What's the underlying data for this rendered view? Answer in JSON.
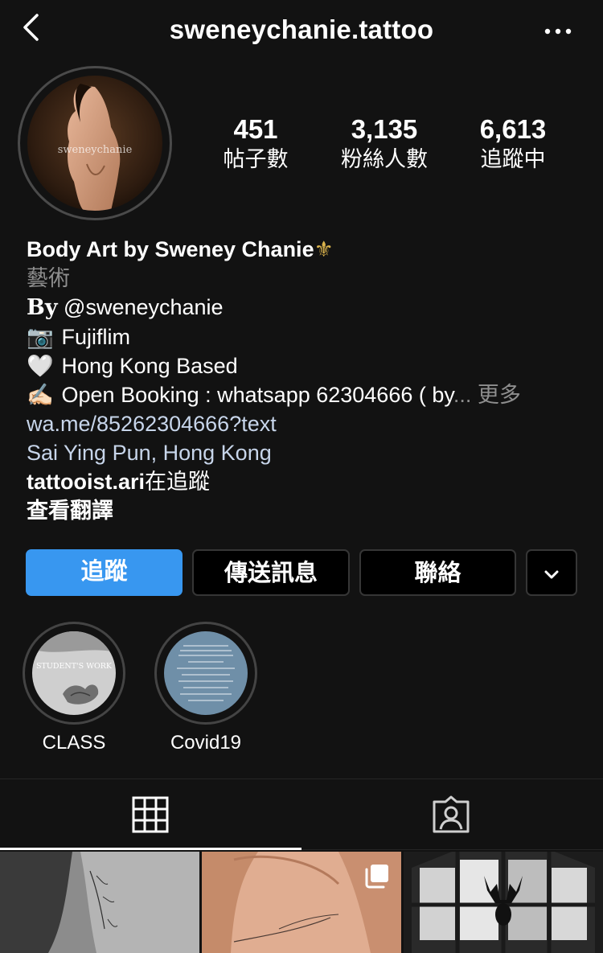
{
  "header": {
    "username": "sweneychanie.tattoo"
  },
  "profile": {
    "avatar_watermark": "sweneychanie",
    "stats": [
      {
        "count": "451",
        "label": "帖子數"
      },
      {
        "count": "3,135",
        "label": "粉絲人數"
      },
      {
        "count": "6,613",
        "label": "追蹤中"
      }
    ]
  },
  "bio": {
    "name": "Body Art by Sweney Chanie",
    "name_emoji": "⚜",
    "category": "藝術",
    "by_prefix": "𝐁𝐲",
    "by_handle": "@sweneychanie",
    "lines": [
      {
        "emoji": "📷",
        "text": "Fujiflim"
      },
      {
        "emoji": "🤍",
        "text": "Hong Kong Based"
      },
      {
        "emoji": "✍🏻",
        "text": "Open Booking : whatsapp 62304666 ( by"
      }
    ],
    "more_ellipsis": "...",
    "more_label": "更多",
    "website": "wa.me/85262304666?text",
    "location": "Sai Ying Pun, Hong Kong",
    "followed_by_user": "tattooist.ari",
    "followed_by_suffix": "在追蹤",
    "translate": "查看翻譯"
  },
  "actions": {
    "follow": "追蹤",
    "message": "傳送訊息",
    "contact": "聯絡"
  },
  "highlights": [
    {
      "label": "CLASS",
      "cover_text": "STUDENT'S WORK"
    },
    {
      "label": "Covid19"
    }
  ],
  "colors": {
    "background": "#121212",
    "accent": "#3897f0",
    "muted": "#8e8e8e",
    "link": "#c7d5ea",
    "border": "#363636"
  },
  "icons": {
    "back": "chevron-left-icon",
    "more": "ellipsis-icon",
    "dropdown": "chevron-down-icon",
    "grid_tab": "grid-icon",
    "tagged_tab": "tagged-person-icon",
    "multi_post": "carousel-icon"
  }
}
